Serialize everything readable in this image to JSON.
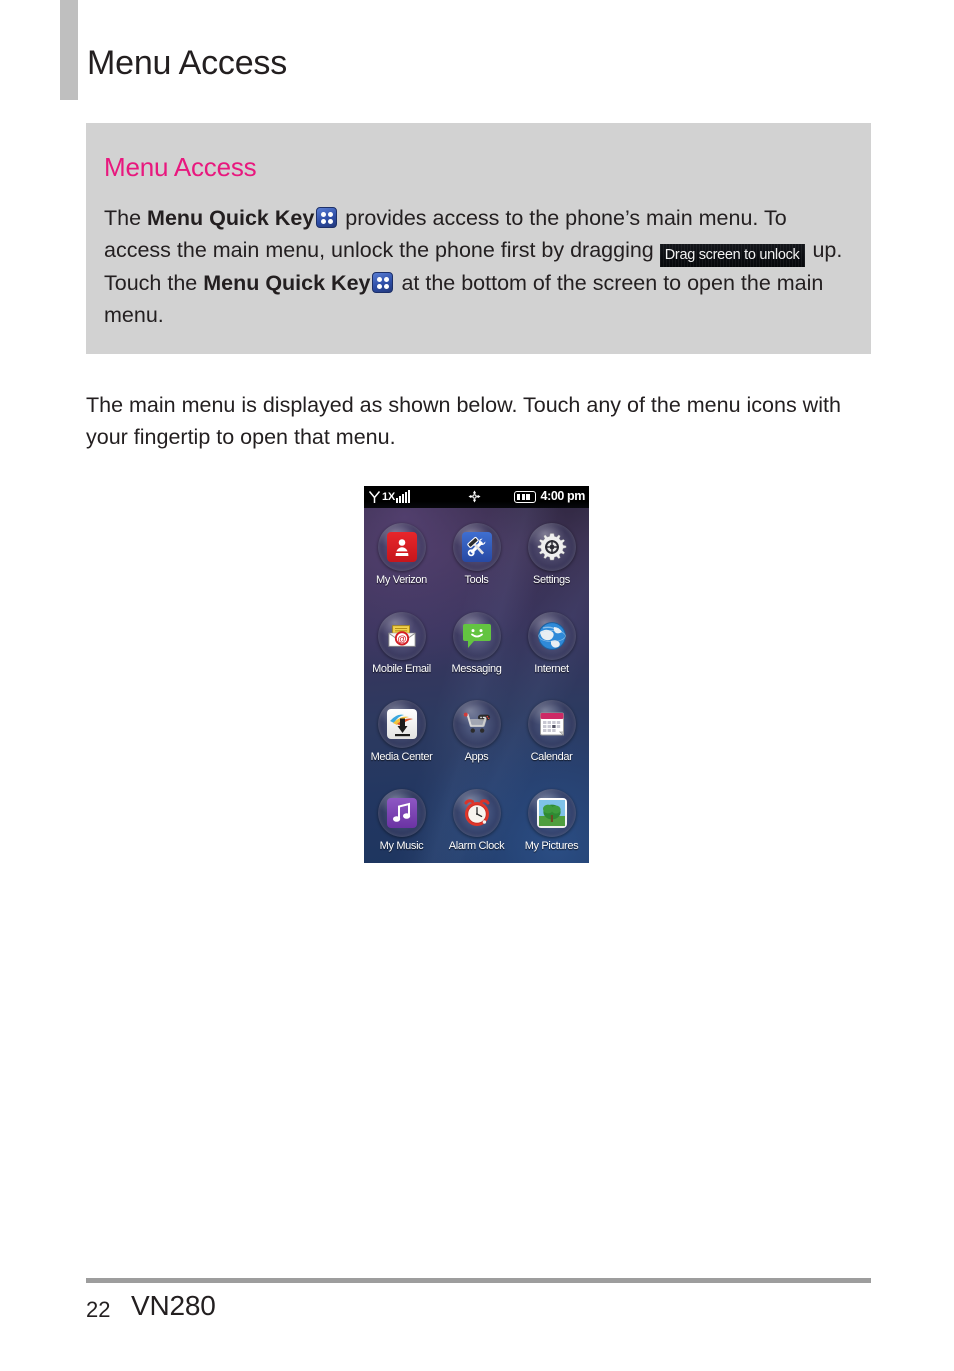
{
  "page": {
    "title": "Menu Access"
  },
  "callout": {
    "heading": "Menu Access",
    "text_part_1": "The ",
    "bold_1": "Menu Quick Key",
    "text_part_2": " provides access to the phone’s main menu. To access the main menu, unlock the phone first by dragging ",
    "unlock_badge": "Drag screen to unlock",
    "text_part_3": " up. Touch the ",
    "bold_2": "Menu Quick Key",
    "text_part_4": " at the bottom of the screen to open the main menu.",
    "quick_key_icon": "menu-quick-key-icon",
    "background_color": "#d2d2d2",
    "heading_color": "#e8187e"
  },
  "intro": {
    "paragraph": "The main menu is displayed as shown below. Touch any of the menu icons with your fingertip to open that menu."
  },
  "phone": {
    "status_bar": {
      "signal_icon": "signal-antenna-icon",
      "network": "1X",
      "signal_bars": 5,
      "gps_icon": "gps-location-icon",
      "battery_icon": "battery-icon",
      "battery_level": 3,
      "time": "4:00 pm"
    },
    "menu_items": [
      {
        "label": "My Verizon",
        "icon": "my-verizon-icon",
        "color": "#d4191f"
      },
      {
        "label": "Tools",
        "icon": "tools-icon",
        "color": "#2f54ab"
      },
      {
        "label": "Settings",
        "icon": "settings-gear-icon",
        "color": "#e8e8e8"
      },
      {
        "label": "Mobile Email",
        "icon": "mobile-email-icon",
        "color": "#e8c23a"
      },
      {
        "label": "Messaging",
        "icon": "messaging-icon",
        "color": "#5fbf3f"
      },
      {
        "label": "Internet",
        "icon": "internet-globe-icon",
        "color": "#2a7fd4"
      },
      {
        "label": "Media Center",
        "icon": "media-center-icon",
        "color": "#ffffff"
      },
      {
        "label": "Apps",
        "icon": "apps-cart-icon",
        "color": "#d8d8d8"
      },
      {
        "label": "Calendar",
        "icon": "calendar-icon",
        "color": "#d02a66"
      },
      {
        "label": "My Music",
        "icon": "my-music-icon",
        "color": "#7a3fb0"
      },
      {
        "label": "Alarm Clock",
        "icon": "alarm-clock-icon",
        "color": "#e03025"
      },
      {
        "label": "My Pictures",
        "icon": "my-pictures-icon",
        "color": "#3f9b3f"
      }
    ]
  },
  "footer": {
    "page_number": "22",
    "model": "VN280"
  }
}
